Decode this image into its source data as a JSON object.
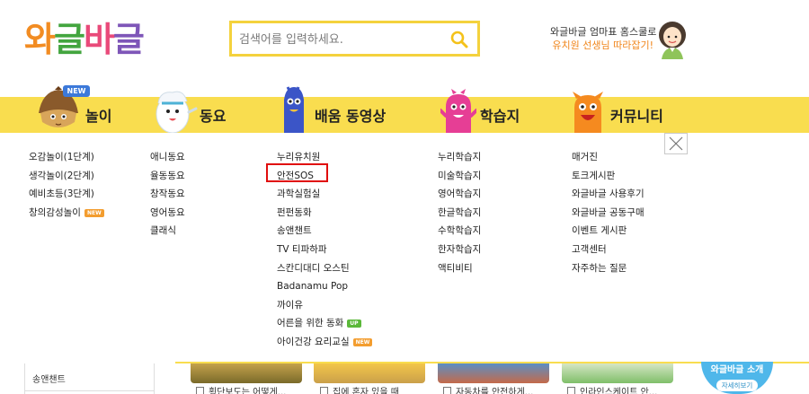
{
  "logo": {
    "chars": [
      "와",
      "글",
      "바",
      "글"
    ],
    "colors": [
      "#f28c22",
      "#43a53f",
      "#e94a7a",
      "#7e56b8"
    ]
  },
  "search": {
    "placeholder": "검색어를 입력하세요."
  },
  "promo": {
    "line1": "와글바글 엄마표 홈스쿨로",
    "line2": "유치원 선생님 따라잡기!"
  },
  "nav": {
    "new_badge": "NEW",
    "items": [
      {
        "label": "놀이"
      },
      {
        "label": "동요"
      },
      {
        "label": "배움 동영상"
      },
      {
        "label": "학습지"
      },
      {
        "label": "커뮤니티"
      }
    ]
  },
  "menu": {
    "columns": [
      [
        {
          "label": "오감놀이(1단계)"
        },
        {
          "label": "생각놀이(2단계)"
        },
        {
          "label": "예비초등(3단계)"
        },
        {
          "label": "창의감성놀이",
          "tag": "NEW"
        }
      ],
      [
        {
          "label": "애니동요"
        },
        {
          "label": "율동동요"
        },
        {
          "label": "창작동요"
        },
        {
          "label": "영어동요"
        },
        {
          "label": "클래식"
        }
      ],
      [
        {
          "label": "누리유치원"
        },
        {
          "label": "안전SOS"
        },
        {
          "label": "과학실험실"
        },
        {
          "label": "펀펀동화"
        },
        {
          "label": "송앤챈트"
        },
        {
          "label": "TV 티파하파"
        },
        {
          "label": "스칸디대디 오스틴"
        },
        {
          "label": "Badanamu Pop"
        },
        {
          "label": "까이유"
        },
        {
          "label": "어른을 위한 동화",
          "tag": "UP"
        },
        {
          "label": "아이건강 요리교실",
          "tag": "NEW"
        }
      ],
      [
        {
          "label": "누리학습지"
        },
        {
          "label": "미술학습지"
        },
        {
          "label": "영어학습지"
        },
        {
          "label": "한글학습지"
        },
        {
          "label": "수학학습지"
        },
        {
          "label": "한자학습지"
        },
        {
          "label": "액티비티"
        }
      ],
      [
        {
          "label": "매거진"
        },
        {
          "label": "토크게시판"
        },
        {
          "label": "와글바글 사용후기"
        },
        {
          "label": "와글바글 공동구매"
        },
        {
          "label": "이벤트 게시판"
        },
        {
          "label": "고객센터"
        },
        {
          "label": "자주하는 질문"
        }
      ]
    ]
  },
  "bottom": {
    "side_label": "송앤챈트",
    "captions": [
      "횡단보도는 어떻게...",
      "집에 혼자 있을 때",
      "자동차를 안전하게...",
      "인라인스케이트 안..."
    ],
    "ad_title": "와글바글 소개",
    "ad_button": "자세히보기"
  }
}
